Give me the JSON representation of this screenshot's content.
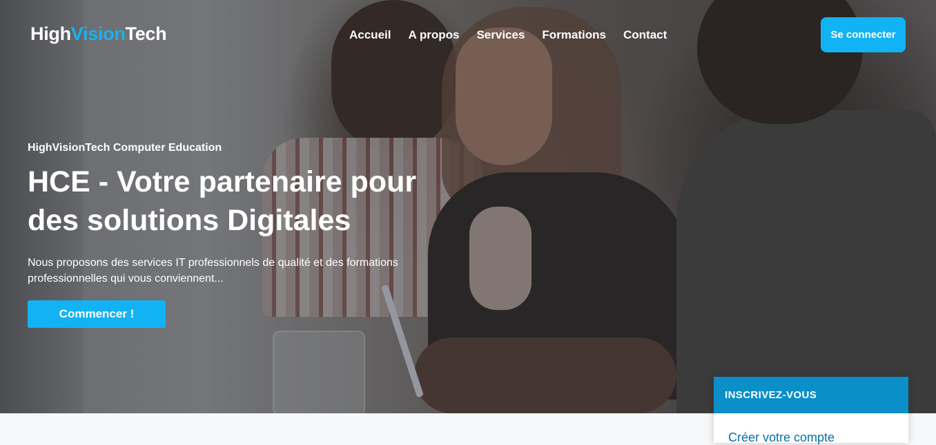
{
  "brand": {
    "part1": "High",
    "part2": "Vision",
    "part3": "Tech",
    "accent_color": "#19b2f0"
  },
  "nav": {
    "items": [
      "Accueil",
      "A propos",
      "Services",
      "Formations",
      "Contact"
    ]
  },
  "login_button": "Se connecter",
  "hero": {
    "eyebrow": "HighVisionTech Computer Education",
    "title": "HCE - Votre partenaire pour des solutions Digitales",
    "lead": "Nous proposons des services IT professionnels de qualité et des formations professionnelles qui vous conviennent...",
    "cta": "Commencer !"
  },
  "signup_card": {
    "heading": "INSCRIVEZ-VOUS",
    "link": "Créer votre compte"
  },
  "colors": {
    "primary": "#12b3f5",
    "card_header": "#0a8fc9"
  }
}
